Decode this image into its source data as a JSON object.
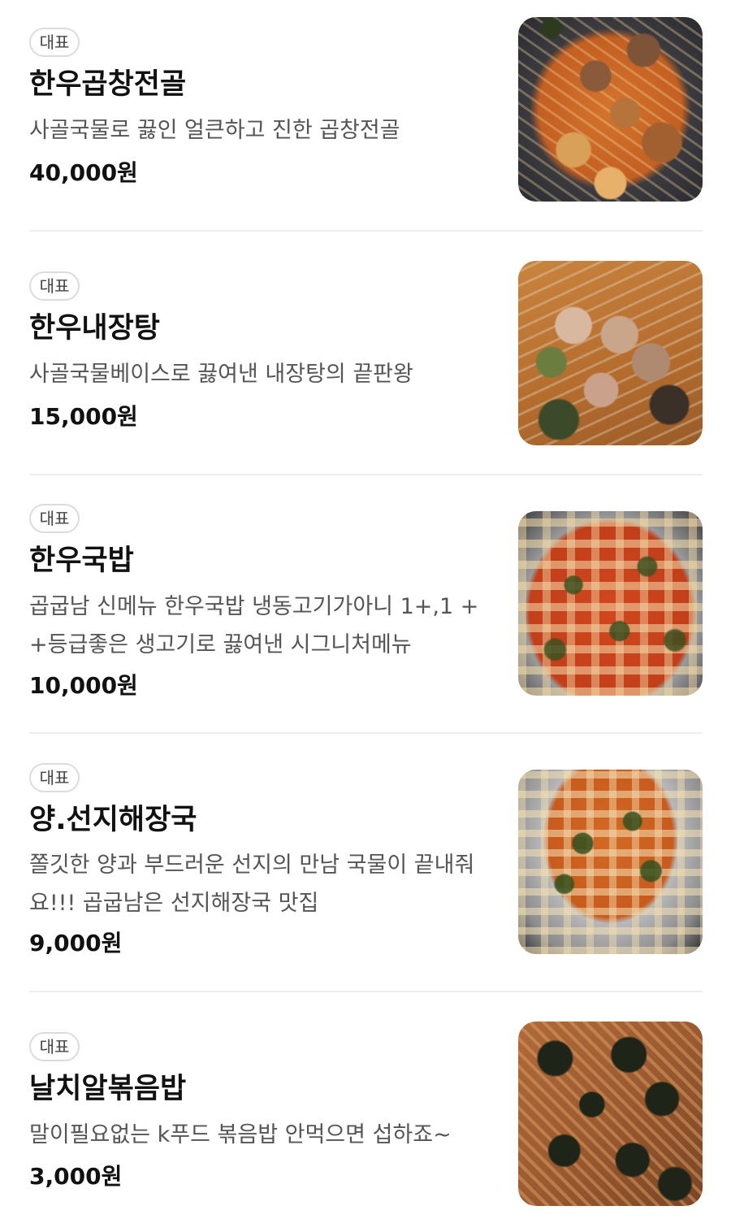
{
  "menu": {
    "items": [
      {
        "badge": "대표",
        "name": "한우곱창전골",
        "description": "사골국물로 끓인 얼큰하고 진한 곱창전골",
        "price": "40,000원",
        "image_icon": "food-photo-gopchang-jeongol"
      },
      {
        "badge": "대표",
        "name": "한우내장탕",
        "description": "사골국물베이스로 끓여낸 내장탕의 끝판왕",
        "price": "15,000원",
        "image_icon": "food-photo-naejangtang"
      },
      {
        "badge": "대표",
        "name": "한우국밥",
        "description": "곱굽남 신메뉴 한우국밥 냉동고기가아니 1+,1 ++등급좋은 생고기로 끓여낸 시그니처메뉴",
        "price": "10,000원",
        "image_icon": "food-photo-gukbap"
      },
      {
        "badge": "대표",
        "name": "양.선지해장국",
        "description": "쫄깃한 양과 부드러운 선지의 만남 국물이 끝내줘요!!! 곱굽남은 선지해장국 맛집",
        "price": "9,000원",
        "image_icon": "food-photo-seonji-haejangguk"
      },
      {
        "badge": "대표",
        "name": "날치알볶음밥",
        "description": "말이필요없는 k푸드 볶음밥 안먹으면 섭하죠~",
        "price": "3,000원",
        "image_icon": "food-photo-bokkeumbap"
      }
    ]
  },
  "colors": {
    "text_primary": "#111111",
    "text_secondary": "#555555",
    "badge_border": "#dcdcdc",
    "divider": "#efefef"
  }
}
